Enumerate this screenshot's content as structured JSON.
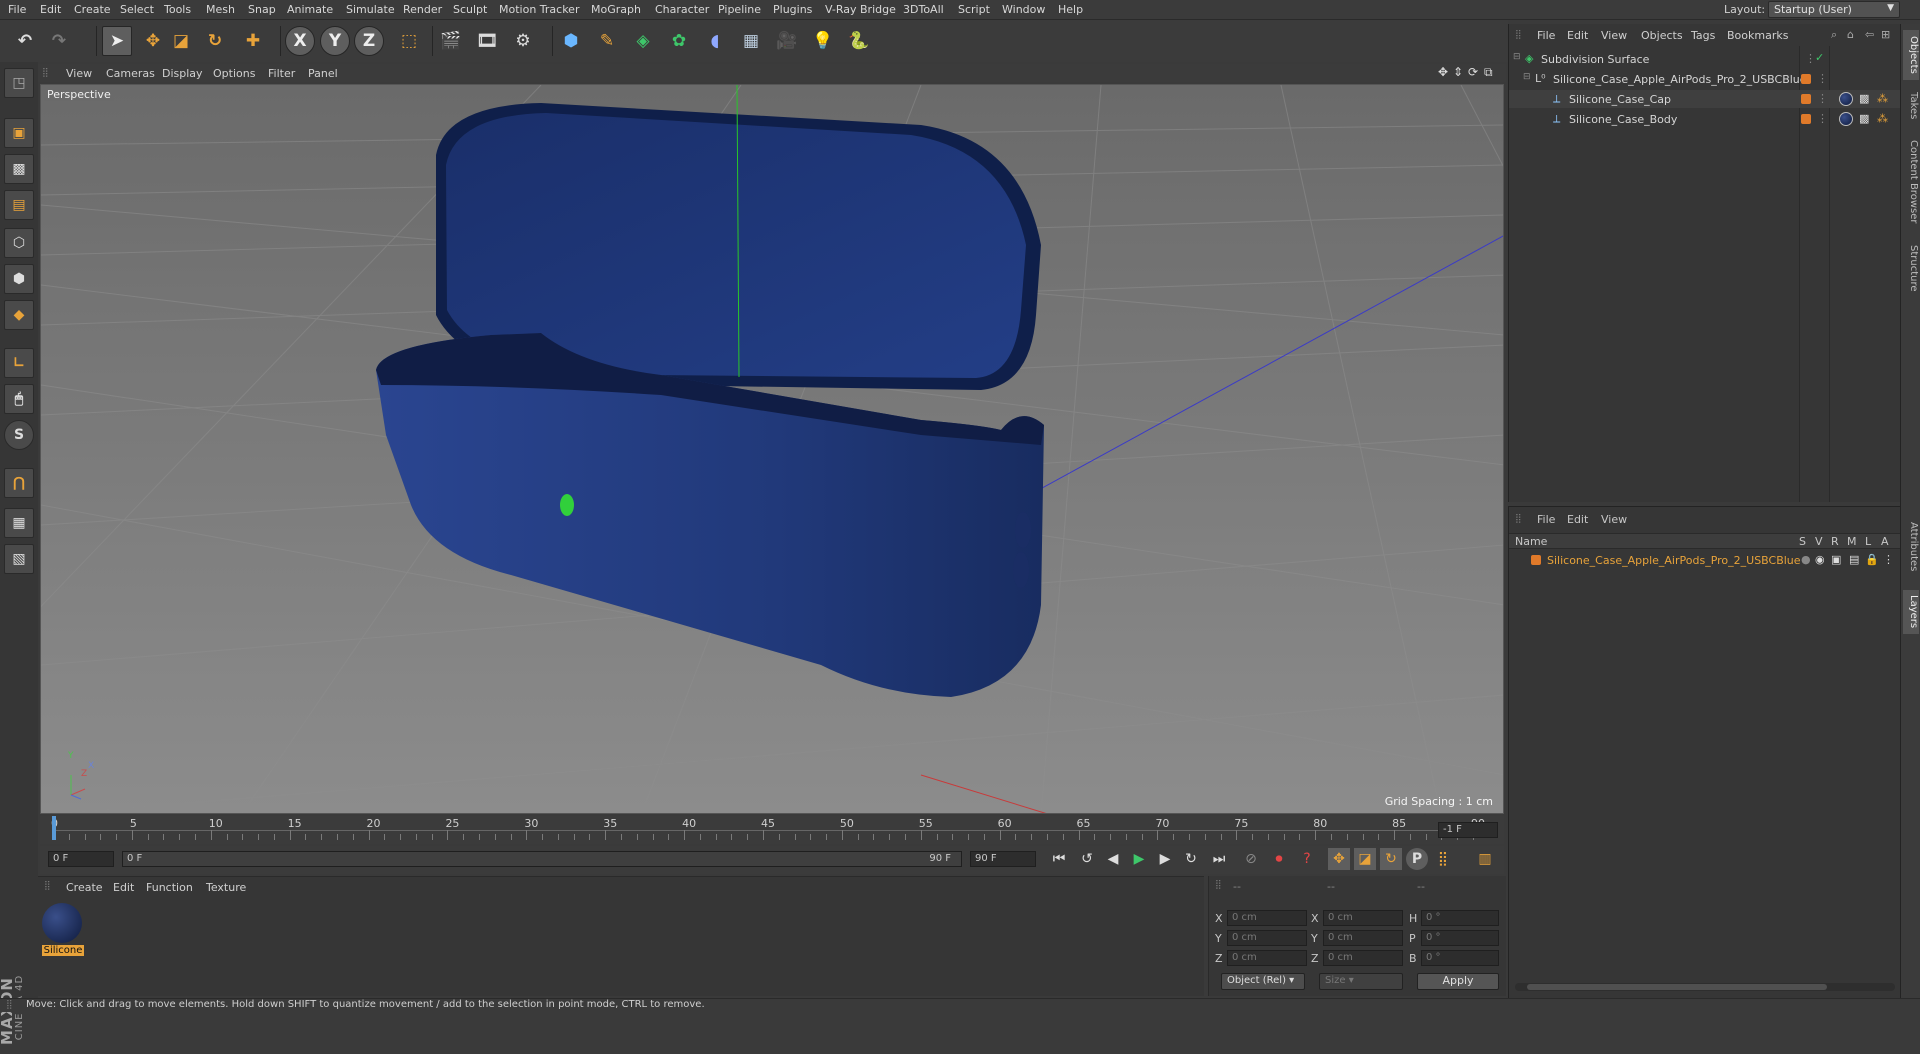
{
  "menubar": {
    "items": [
      "File",
      "Edit",
      "Create",
      "Select",
      "Tools",
      "Mesh",
      "Snap",
      "Animate",
      "Simulate",
      "Render",
      "Sculpt",
      "Motion Tracker",
      "MoGraph",
      "Character",
      "Pipeline",
      "Plugins",
      "V-Ray Bridge",
      "3DToAll",
      "Script",
      "Window",
      "Help"
    ],
    "layout_label": "Layout:",
    "layout_value": "Startup (User)"
  },
  "toolbar": {
    "axis_x": "X",
    "axis_y": "Y",
    "axis_z": "Z"
  },
  "left_tools": {
    "s_label": "S"
  },
  "brand": {
    "maxon": "MAXON",
    "product": "CINEMA 4D"
  },
  "viewport": {
    "menu": [
      "View",
      "Cameras",
      "Display",
      "Options",
      "Filter",
      "Panel"
    ],
    "label": "Perspective",
    "grid_spacing": "Grid Spacing : 1 cm",
    "axis_y": "Y",
    "axis_z": "Z",
    "axis_x": "X"
  },
  "timeline": {
    "ticks": [
      "0",
      "5",
      "10",
      "15",
      "20",
      "25",
      "30",
      "35",
      "40",
      "45",
      "50",
      "55",
      "60",
      "65",
      "70",
      "75",
      "80",
      "85",
      "90"
    ],
    "current_frame_display": "-1 F"
  },
  "transport": {
    "start_frame": "0 F",
    "range_start": "0 F",
    "range_end": "90 F",
    "end_frame": "90 F",
    "p_label": "P"
  },
  "material_panel": {
    "menu": [
      "Create",
      "Edit",
      "Function",
      "Texture"
    ],
    "materials": [
      {
        "name": "Silicone",
        "color": "#1c2a5c"
      }
    ]
  },
  "coordinates": {
    "header": [
      "--",
      "--",
      "--"
    ],
    "rows": [
      {
        "a": "X",
        "v1": "0 cm",
        "b": "X",
        "v2": "0 cm",
        "c": "H",
        "v3": "0 °"
      },
      {
        "a": "Y",
        "v1": "0 cm",
        "b": "Y",
        "v2": "0 cm",
        "c": "P",
        "v3": "0 °"
      },
      {
        "a": "Z",
        "v1": "0 cm",
        "b": "Z",
        "v2": "0 cm",
        "c": "B",
        "v3": "0 °"
      }
    ],
    "mode": "Object (Rel)",
    "size_mode": "Size",
    "apply": "Apply"
  },
  "object_manager": {
    "menu": [
      "File",
      "Edit",
      "View",
      "Objects",
      "Tags",
      "Bookmarks"
    ],
    "objects": [
      {
        "name": "Subdivision Surface",
        "level": 0,
        "icon": "subdivision-icon"
      },
      {
        "name": "Silicone_Case_Apple_AirPods_Pro_2_USBCBlue",
        "level": 1,
        "icon": "null-icon"
      },
      {
        "name": "Silicone_Case_Cap",
        "level": 2,
        "icon": "polygon-icon"
      },
      {
        "name": "Silicone_Case_Body",
        "level": 2,
        "icon": "polygon-icon"
      }
    ]
  },
  "layer_manager": {
    "menu": [
      "File",
      "Edit",
      "View"
    ],
    "columns": [
      "Name",
      "S",
      "V",
      "R",
      "M",
      "L",
      "A"
    ],
    "layers": [
      {
        "name": "Silicone_Case_Apple_AirPods_Pro_2_USBCBlue",
        "color": "#e07a2a"
      }
    ]
  },
  "side_tabs": [
    "Objects",
    "Takes",
    "Content Browser",
    "Structure",
    "Attributes",
    "Layers"
  ],
  "status": {
    "message": "Move: Click and drag to move elements. Hold down SHIFT to quantize movement / add to the selection in point mode, CTRL to remove."
  },
  "colors": {
    "accent": "#e8a33a",
    "case_blue": "#1f3a7a",
    "selection_orange": "#e07a2a"
  }
}
